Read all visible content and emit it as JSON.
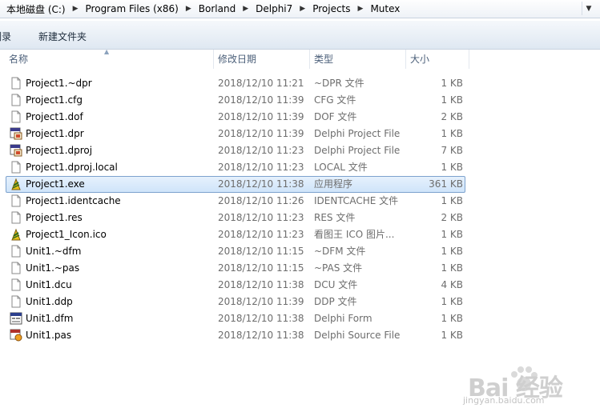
{
  "address": {
    "crumbs": [
      "本地磁盘 (C:)",
      "Program Files (x86)",
      "Borland",
      "Delphi7",
      "Projects",
      "Mutex"
    ]
  },
  "toolbar": {
    "burn_label": "刻录",
    "new_folder_label": "新建文件夹"
  },
  "columns": {
    "name": "名称",
    "date": "修改日期",
    "type": "类型",
    "size": "大小"
  },
  "files": [
    {
      "name": "Project1.~dpr",
      "date": "2018/12/10 11:21",
      "type": "~DPR 文件",
      "size": "1 KB",
      "icon": "generic-file-icon"
    },
    {
      "name": "Project1.cfg",
      "date": "2018/12/10 11:39",
      "type": "CFG 文件",
      "size": "1 KB",
      "icon": "generic-file-icon"
    },
    {
      "name": "Project1.dof",
      "date": "2018/12/10 11:39",
      "type": "DOF 文件",
      "size": "2 KB",
      "icon": "generic-file-icon"
    },
    {
      "name": "Project1.dpr",
      "date": "2018/12/10 11:39",
      "type": "Delphi Project File",
      "size": "1 KB",
      "icon": "delphi-project-icon"
    },
    {
      "name": "Project1.dproj",
      "date": "2018/12/10 11:23",
      "type": "Delphi Project File",
      "size": "7 KB",
      "icon": "delphi-project-icon"
    },
    {
      "name": "Project1.dproj.local",
      "date": "2018/12/10 11:23",
      "type": "LOCAL 文件",
      "size": "1 KB",
      "icon": "generic-file-icon"
    },
    {
      "name": "Project1.exe",
      "date": "2018/12/10 11:38",
      "type": "应用程序",
      "size": "361 KB",
      "icon": "delphi-exe-icon",
      "selected": true
    },
    {
      "name": "Project1.identcache",
      "date": "2018/12/10 11:26",
      "type": "IDENTCACHE 文件",
      "size": "1 KB",
      "icon": "generic-file-icon"
    },
    {
      "name": "Project1.res",
      "date": "2018/12/10 11:23",
      "type": "RES 文件",
      "size": "2 KB",
      "icon": "generic-file-icon"
    },
    {
      "name": "Project1_Icon.ico",
      "date": "2018/12/10 11:23",
      "type": "看图王 ICO 图片...",
      "size": "1 KB",
      "icon": "delphi-exe-icon"
    },
    {
      "name": "Unit1.~dfm",
      "date": "2018/12/10 11:15",
      "type": "~DFM 文件",
      "size": "1 KB",
      "icon": "generic-file-icon"
    },
    {
      "name": "Unit1.~pas",
      "date": "2018/12/10 11:15",
      "type": "~PAS 文件",
      "size": "1 KB",
      "icon": "generic-file-icon"
    },
    {
      "name": "Unit1.dcu",
      "date": "2018/12/10 11:38",
      "type": "DCU 文件",
      "size": "4 KB",
      "icon": "generic-file-icon"
    },
    {
      "name": "Unit1.ddp",
      "date": "2018/12/10 11:39",
      "type": "DDP 文件",
      "size": "1 KB",
      "icon": "generic-file-icon"
    },
    {
      "name": "Unit1.dfm",
      "date": "2018/12/10 11:38",
      "type": "Delphi Form",
      "size": "1 KB",
      "icon": "delphi-form-icon"
    },
    {
      "name": "Unit1.pas",
      "date": "2018/12/10 11:38",
      "type": "Delphi Source File",
      "size": "1 KB",
      "icon": "delphi-source-icon"
    }
  ],
  "watermark": {
    "title": "Bai 经验",
    "url": "jingyan.baidu.com"
  }
}
